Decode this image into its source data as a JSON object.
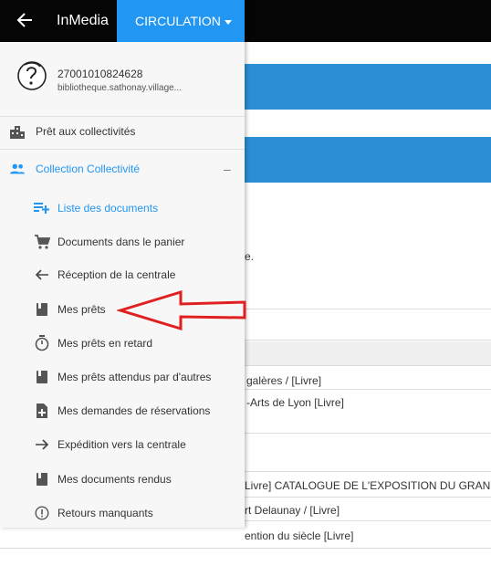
{
  "topbar": {
    "back_icon": "arrow-left-icon",
    "app_title": "InMedia",
    "menu_label": "CIRCULATION"
  },
  "user": {
    "id": "27001010824628",
    "email": "bibliotheque.sathonay.village..."
  },
  "nav": {
    "pret_collectivites": "Prêt aux collectivités",
    "collection_collectivite": "Collection Collectivité",
    "collapse_symbol": "–",
    "sub_items": [
      {
        "label": "Liste des documents",
        "icon": "playlist-add-icon",
        "active": true
      },
      {
        "label": "Documents dans le panier",
        "icon": "cart-icon"
      },
      {
        "label": "Réception de la centrale",
        "icon": "arrow-left-icon"
      },
      {
        "label": "Mes prêts",
        "icon": "book-icon"
      },
      {
        "label": "Mes prêts en retard",
        "icon": "timer-icon"
      },
      {
        "label": "Mes prêts attendus par d'autres",
        "icon": "book-icon"
      },
      {
        "label": "Mes demandes de réservations",
        "icon": "file-plus-icon"
      },
      {
        "label": "Expédition vers la centrale",
        "icon": "arrow-right-icon"
      },
      {
        "label": "Mes documents rendus",
        "icon": "book-icon"
      },
      {
        "label": "Retours manquants",
        "icon": "alert-circle-icon"
      }
    ]
  },
  "background": {
    "fragments": [
      "e.",
      "galères / [Livre]",
      "-Arts de Lyon [Livre]",
      "Livre] CATALOGUE DE L'EXPOSITION DU GRAND",
      "rt Delaunay / [Livre]",
      "ention du siècle [Livre]"
    ]
  },
  "colors": {
    "accent": "#2196f3",
    "topbar": "#050505",
    "annotation": "#e02020"
  }
}
